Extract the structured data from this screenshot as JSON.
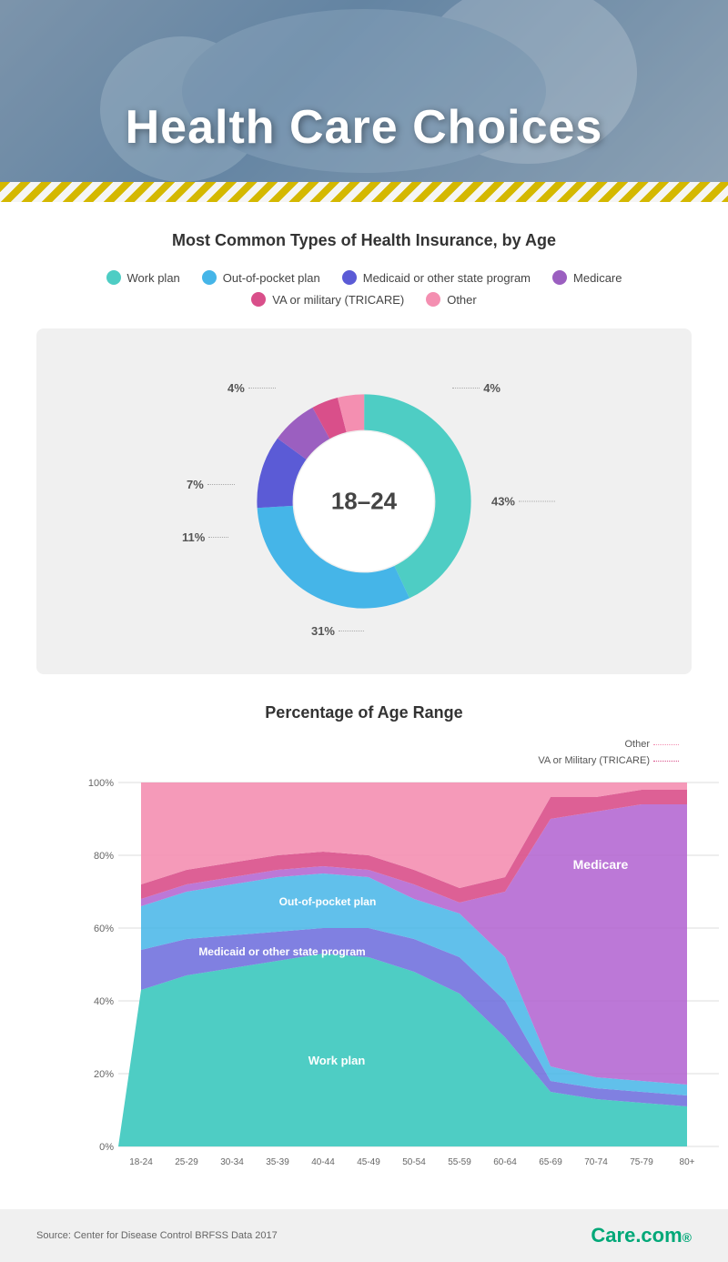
{
  "header": {
    "title": "Health Care Choices",
    "stripe": true
  },
  "section1": {
    "title": "Most Common Types of Health Insurance, by Age"
  },
  "legend": {
    "items": [
      {
        "id": "work-plan",
        "label": "Work plan",
        "color": "#4ecdc4"
      },
      {
        "id": "out-of-pocket",
        "label": "Out-of-pocket plan",
        "color": "#45b5e8"
      },
      {
        "id": "medicaid",
        "label": "Medicaid or other state program",
        "color": "#5b5bd6"
      },
      {
        "id": "medicare",
        "label": "Medicare",
        "color": "#9b5fc0"
      },
      {
        "id": "va-military",
        "label": "VA or military (TRICARE)",
        "color": "#d94f8a"
      },
      {
        "id": "other",
        "label": "Other",
        "color": "#f48fb1"
      }
    ]
  },
  "donut": {
    "center_label": "18–24",
    "segments": [
      {
        "label": "Work plan",
        "value": 43,
        "color": "#4ecdc4",
        "position": "right"
      },
      {
        "label": "Out-of-pocket plan",
        "value": 31,
        "color": "#45b5e8",
        "position": "bottom"
      },
      {
        "label": "Medicaid",
        "value": 11,
        "color": "#5b5bd6",
        "position": "left-mid"
      },
      {
        "label": "Medicare",
        "value": 7,
        "color": "#9b5fc0",
        "position": "left-top"
      },
      {
        "label": "VA/Military",
        "value": 4,
        "color": "#d94f8a",
        "position": "top-left"
      },
      {
        "label": "Other",
        "value": 4,
        "color": "#f48fb1",
        "position": "top-right"
      }
    ]
  },
  "area_chart": {
    "title": "Percentage of Age Range",
    "legend_note_other": "Other",
    "legend_note_va": "VA or Military (TRICARE)",
    "y_labels": [
      "100%",
      "80%",
      "60%",
      "40%",
      "20%",
      "0%"
    ],
    "x_labels": [
      "18-24",
      "25-29",
      "30-34",
      "35-39",
      "40-44",
      "45-49",
      "50-54",
      "55-59",
      "60-64",
      "65-69",
      "70-74",
      "75-79",
      "80+"
    ],
    "series": {
      "work_plan_label": "Work plan",
      "medicaid_label": "Medicaid or other state program",
      "out_of_pocket_label": "Out-of-pocket plan",
      "medicare_label": "Medicare"
    },
    "colors": {
      "work_plan": "#4ecdc4",
      "out_of_pocket": "#45b5e8",
      "medicaid": "#6a6adc",
      "medicare": "#b060d0",
      "va": "#d94f8a",
      "other": "#f48fb1"
    }
  },
  "footer": {
    "source": "Source: Center for Disease Control BRFSS Data 2017",
    "logo": "Care.com"
  }
}
